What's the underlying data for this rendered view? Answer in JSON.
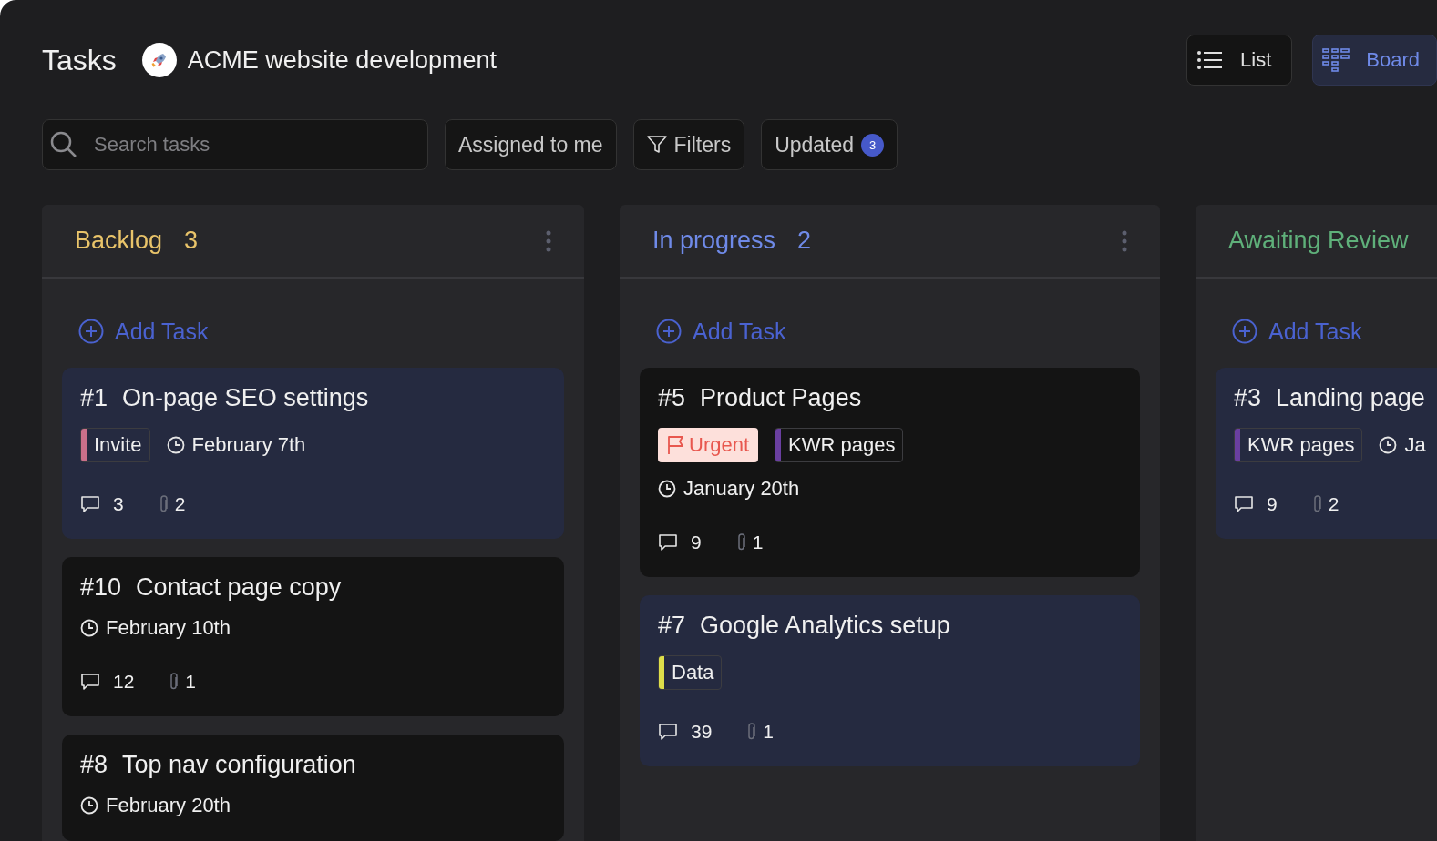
{
  "header": {
    "title": "Tasks",
    "project": "ACME website development"
  },
  "views": [
    {
      "label": "List",
      "kind": "list",
      "selected": false
    },
    {
      "label": "Board",
      "kind": "board",
      "selected": true
    }
  ],
  "search": {
    "placeholder": "Search tasks"
  },
  "filters": [
    {
      "label": "Assigned to me",
      "kind": "plain"
    },
    {
      "label": "Filters",
      "kind": "filter"
    },
    {
      "label": "Updated",
      "kind": "count",
      "count": "3"
    }
  ],
  "columns": [
    {
      "title": "Backlog",
      "count": "3",
      "color": "#e9c46a",
      "menu": true,
      "add_label": "Add Task",
      "cards": [
        {
          "number": "#1",
          "title": "On-page SEO settings",
          "highlighted": true,
          "tags": [
            {
              "kind": "label",
              "label": "Invite",
              "color": "#c9708a"
            }
          ],
          "date": "February 7th",
          "date_inline": true,
          "comments": "3",
          "attachments": "2"
        },
        {
          "number": "#10",
          "title": "Contact page copy",
          "highlighted": false,
          "date": "February 10th",
          "date_inline": false,
          "comments": "12",
          "attachments": "1"
        },
        {
          "number": "#8",
          "title": "Top nav configuration",
          "highlighted": false,
          "date": "February 20th",
          "date_inline": false
        }
      ]
    },
    {
      "title": "In progress",
      "count": "2",
      "color": "#6f8ae8",
      "menu": true,
      "add_label": "Add Task",
      "cards": [
        {
          "number": "#5",
          "title": "Product Pages",
          "highlighted": false,
          "tags": [
            {
              "kind": "priority",
              "label": "Urgent"
            },
            {
              "kind": "label",
              "label": "KWR pages",
              "color": "#6a3fa0"
            }
          ],
          "date": "January 20th",
          "date_inline": false,
          "comments": "9",
          "attachments": "1"
        },
        {
          "number": "#7",
          "title": "Google Analytics setup",
          "highlighted": true,
          "tags": [
            {
              "kind": "label",
              "label": "Data",
              "color": "#dede4a"
            }
          ],
          "comments": "39",
          "attachments": "1"
        }
      ]
    },
    {
      "title": "Awaiting Review",
      "color": "#5fb07a",
      "menu": false,
      "add_label": "Add Task",
      "cards": [
        {
          "number": "#3",
          "title": "Landing page",
          "highlighted": true,
          "tags": [
            {
              "kind": "label",
              "label": "KWR pages",
              "color": "#6a3fa0"
            }
          ],
          "date": "Ja",
          "date_inline": true,
          "comments": "9",
          "attachments": "2"
        }
      ]
    }
  ]
}
